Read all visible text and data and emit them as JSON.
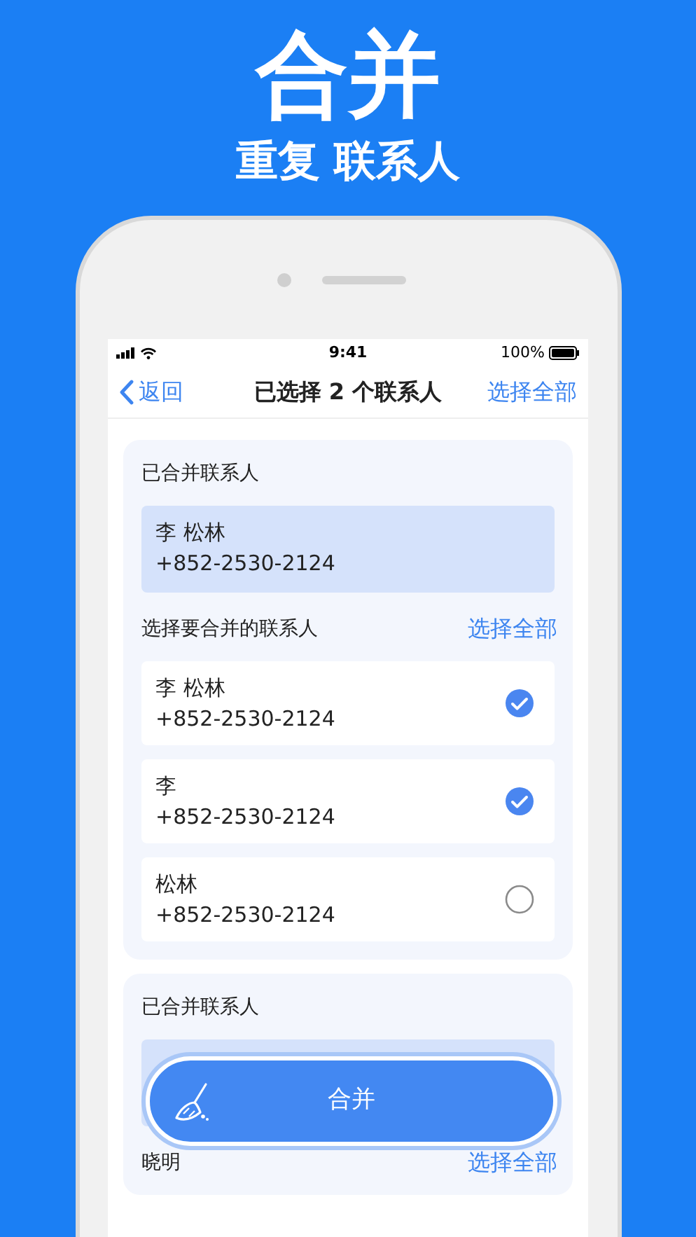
{
  "headline": "合并",
  "subheadline": "重复 联系人",
  "status_bar": {
    "time": "9:41",
    "battery": "100%"
  },
  "nav": {
    "back": "返回",
    "title": "已选择 2 个联系人",
    "action": "选择全部"
  },
  "groups": [
    {
      "merged_label": "已合并联系人",
      "merged": {
        "name": "李 松林",
        "phone": "+852-2530-2124"
      },
      "select_label": "选择要合并的联系人",
      "select_all": "选择全部",
      "contacts": [
        {
          "name": "李 松林",
          "phone": "+852-2530-2124",
          "selected": true
        },
        {
          "name": "李",
          "phone": "+852-2530-2124",
          "selected": true
        },
        {
          "name": "松林",
          "phone": "+852-2530-2124",
          "selected": false
        }
      ]
    },
    {
      "merged_label": "已合并联系人",
      "select_label": "晓明",
      "select_all": "选择全部"
    }
  ],
  "merge_button": {
    "label": "合并"
  }
}
